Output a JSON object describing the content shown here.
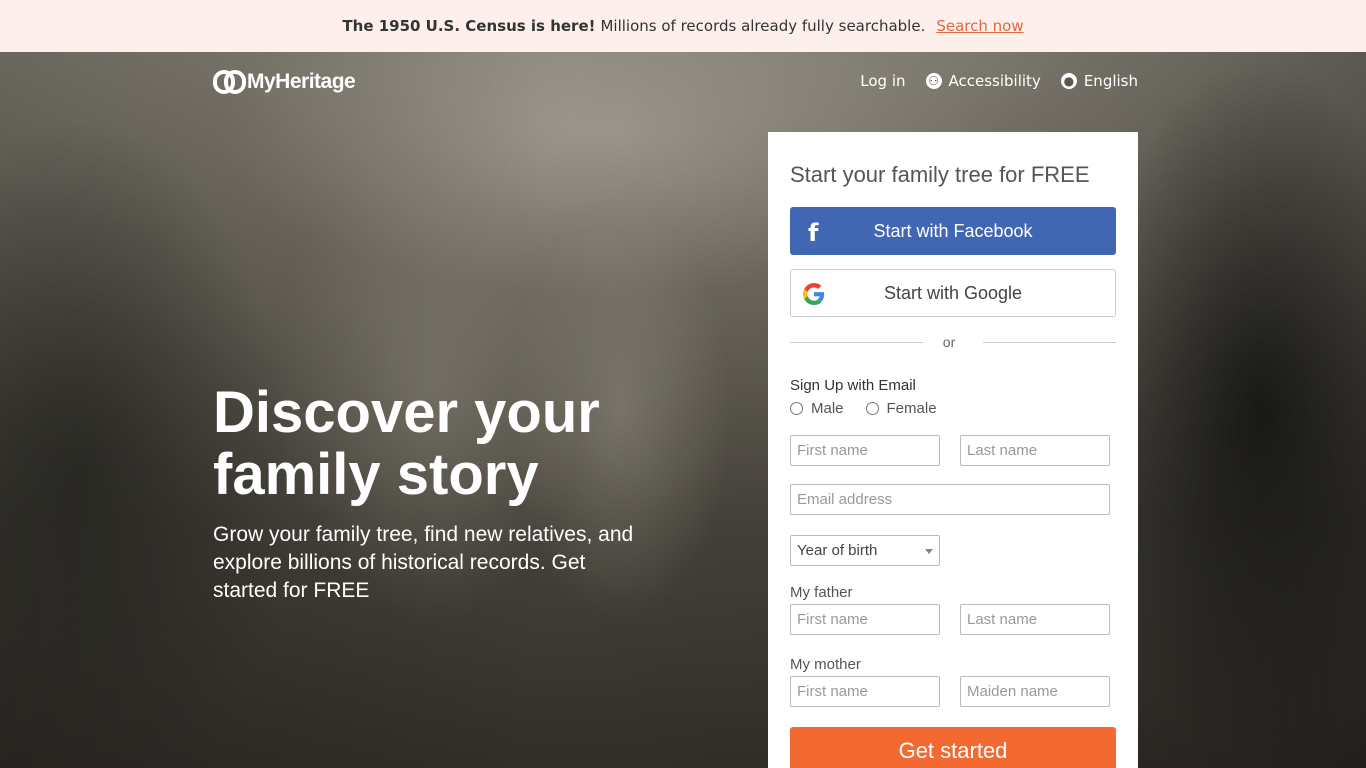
{
  "banner": {
    "bold": "The 1950 U.S. Census is here!",
    "message": "Millions of records already fully searchable.",
    "link": "Search now",
    "bg_color": "#fdf0ec",
    "link_color": "#e4683a"
  },
  "header": {
    "logo_text": "MyHeritage",
    "login": "Log in",
    "accessibility": "Accessibility",
    "language": "English",
    "accessibility_icon": "accessibility-icon",
    "language_icon": "globe-icon"
  },
  "hero": {
    "title": "Discover your family story",
    "subtitle": "Grow your family tree, find new relatives, and explore billions of historical records. Get started for FREE"
  },
  "form": {
    "heading": "Start your family tree for FREE",
    "facebook_button": "Start with Facebook",
    "google_button": "Start with Google",
    "or": "or",
    "email_section": "Sign Up with Email",
    "gender_male": "Male",
    "gender_female": "Female",
    "first_name_placeholder": "First name",
    "last_name_placeholder": "Last name",
    "email_placeholder": "Email address",
    "year_of_birth": "Year of birth",
    "father_label": "My father",
    "father_first_placeholder": "First name",
    "father_last_placeholder": "Last name",
    "mother_label": "My mother",
    "mother_first_placeholder": "First name",
    "mother_maiden_placeholder": "Maiden name",
    "submit": "Get started",
    "facebook_color": "#4267b2",
    "submit_color": "#f26a32"
  }
}
